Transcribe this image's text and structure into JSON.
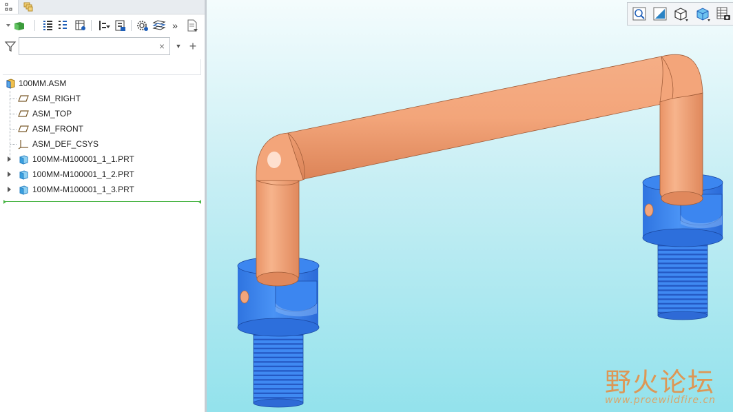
{
  "panel_tabs": [
    {
      "name": "model-tree",
      "icon": "model-tree-tab-icon"
    },
    {
      "name": "layers",
      "icon": "layers-tab-icon"
    }
  ],
  "model_tree_toolbar": {
    "icons": [
      "show-icon",
      "tree-columns-icon",
      "tree-filters-icon",
      "settings-table-icon",
      "filter-dropdown-icon",
      "tree-settings-icon",
      "gear-icon",
      "layers-icon",
      "more-icon",
      "notes-icon"
    ]
  },
  "search": {
    "value": "",
    "placeholder": "",
    "clear_symbol": "×",
    "dropdown_symbol": "▼",
    "add_symbol": "+"
  },
  "tree": {
    "root": {
      "label": "100MM.ASM",
      "icon": "assembly-icon"
    },
    "items": [
      {
        "label": "ASM_RIGHT",
        "icon": "datum-plane-icon",
        "expandable": false
      },
      {
        "label": "ASM_TOP",
        "icon": "datum-plane-icon",
        "expandable": false
      },
      {
        "label": "ASM_FRONT",
        "icon": "datum-plane-icon",
        "expandable": false
      },
      {
        "label": "ASM_DEF_CSYS",
        "icon": "csys-icon",
        "expandable": false
      },
      {
        "label": "100MM-M100001_1_1.PRT",
        "icon": "part-icon",
        "expandable": true
      },
      {
        "label": "100MM-M100001_1_2.PRT",
        "icon": "part-icon",
        "expandable": true
      },
      {
        "label": "100MM-M100001_1_3.PRT",
        "icon": "part-icon",
        "expandable": true
      }
    ]
  },
  "graphics_toolbar": {
    "icons": [
      "refit-zoom-icon",
      "zoom-window-icon",
      "display-style-icon",
      "saved-views-icon",
      "view-manager-icon"
    ]
  },
  "colors": {
    "pipe": "#f3a57a",
    "pipe_shadow": "#d77f55",
    "base": "#3c86f0",
    "base_dark": "#2463cc",
    "background_top": "#f4fcfd",
    "background_bottom": "#93e2ec"
  },
  "watermark": {
    "title": "野火论坛",
    "url": "www.proewildfire.cn"
  }
}
